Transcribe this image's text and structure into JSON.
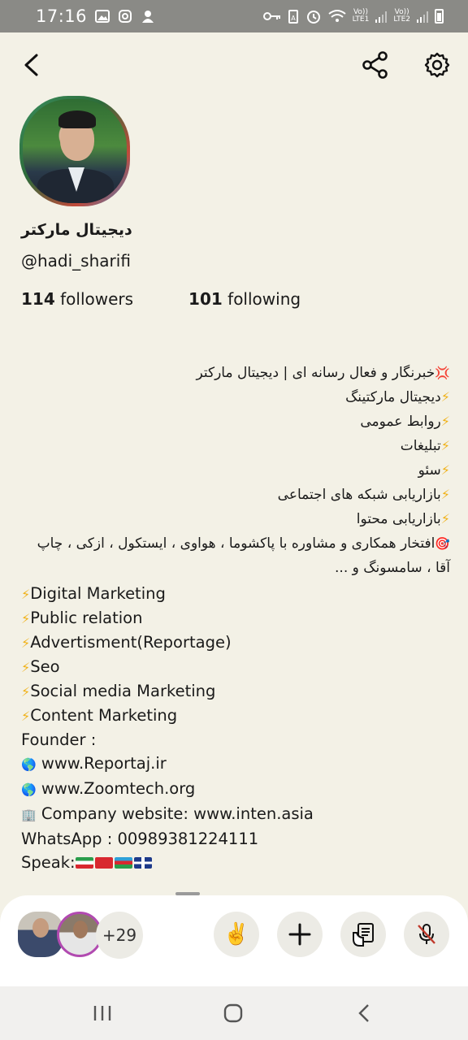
{
  "status_bar": {
    "time": "17:16",
    "sim1_label_top": "Vo))",
    "sim1_label_bottom": "LTE1",
    "sim2_label_top": "Vo))",
    "sim2_label_bottom": "LTE2"
  },
  "profile": {
    "display_name": "دیجیتال مارکتر",
    "username": "@hadi_sharifi",
    "followers_count": "114",
    "followers_label": "followers",
    "following_count": "101",
    "following_label": "following"
  },
  "bio_rtl": [
    {
      "emoji": "💢",
      "text": "خبرنگار و فعال رسانه ای | دیجیتال مارکتر"
    },
    {
      "emoji": "⚡",
      "text": "دیجیتال مارکتینگ"
    },
    {
      "emoji": "⚡",
      "text": "روابط عمومی"
    },
    {
      "emoji": "⚡",
      "text": "تبلیغات"
    },
    {
      "emoji": "⚡",
      "text": "سئو"
    },
    {
      "emoji": "⚡",
      "text": "بازاریابی شبکه های اجتماعی"
    },
    {
      "emoji": "⚡",
      "text": "بازاریابی محتوا"
    },
    {
      "emoji": "🎯",
      "text": "افتخار همکاری و مشاوره با پاکشوما ، هواوی ، ایستکول ، ازکی ، چاپ آقا ، سامسونگ و ..."
    }
  ],
  "bio_ltr": [
    {
      "emoji": "⚡",
      "text": "Digital Marketing"
    },
    {
      "emoji": "⚡",
      "text": "Public relation"
    },
    {
      "emoji": "⚡",
      "text": "Advertisment(Reportage)"
    },
    {
      "emoji": "⚡",
      "text": "Seo"
    },
    {
      "emoji": "⚡",
      "text": "Social media Marketing"
    },
    {
      "emoji": "⚡",
      "text": "Content Marketing"
    },
    {
      "emoji": "",
      "text": "Founder :"
    },
    {
      "emoji": "🌎",
      "text": "www.Reportaj.ir"
    },
    {
      "emoji": "🌎",
      "text": "www.Zoomtech.org"
    },
    {
      "emoji": "🏢",
      "text": "Company website: www.inten.asia"
    },
    {
      "emoji": "",
      "text": "WhatsApp : 00989381224111"
    },
    {
      "emoji": "",
      "text": "Speak:"
    }
  ],
  "room_bar": {
    "more_speakers": "+29",
    "wave_emoji": "✌️"
  },
  "colors": {
    "background": "#f3f1e6",
    "status_bar": "#8a8a86",
    "bolt": "#f0b21a",
    "speaker_ring": "#b14ab0"
  },
  "icons": [
    "back-arrow-icon",
    "share-icon",
    "settings-gear-icon",
    "plus-icon",
    "raise-hand-icon",
    "mic-muted-icon"
  ]
}
